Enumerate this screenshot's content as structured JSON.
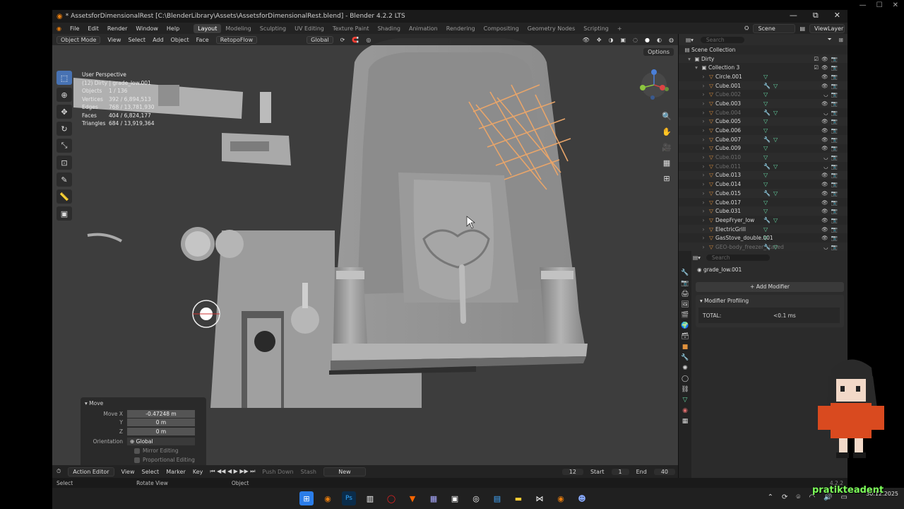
{
  "window": {
    "title": "* AssetsforDimensionalRest [C:\\BlenderLibrary\\Assets\\AssetsforDimensionalRest.blend] - Blender 4.2.2 LTS"
  },
  "menu": {
    "items": [
      "File",
      "Edit",
      "Render",
      "Window",
      "Help"
    ],
    "workspaces": [
      "Layout",
      "Modeling",
      "Sculpting",
      "UV Editing",
      "Texture Paint",
      "Shading",
      "Animation",
      "Rendering",
      "Compositing",
      "Geometry Nodes",
      "Scripting"
    ],
    "active_workspace": "Layout",
    "scene": "Scene",
    "view_layer": "ViewLayer"
  },
  "viewport_header": {
    "mode": "Object Mode",
    "menus": [
      "View",
      "Select",
      "Add",
      "Object",
      "Face",
      "RetopoFlow"
    ],
    "transform_orientation": "Global",
    "options_label": "Options"
  },
  "stats": {
    "view_name": "User Perspective",
    "object_name": "(12) Dirty | grade_low.001",
    "rows": [
      {
        "label": "Objects",
        "value": "1 / 136"
      },
      {
        "label": "Vertices",
        "value": "392 / 6,894,513"
      },
      {
        "label": "Edges",
        "value": "768 / 13,781,930"
      },
      {
        "label": "Faces",
        "value": "404 / 6,824,177"
      },
      {
        "label": "Triangles",
        "value": "684 / 13,919,364"
      }
    ]
  },
  "last_operation": {
    "title": "Move",
    "move_x_label": "Move X",
    "move_x": "-0.47248 m",
    "y_label": "Y",
    "y": "0 m",
    "z_label": "Z",
    "z": "0 m",
    "orientation_label": "Orientation",
    "orientation": "Global",
    "mirror_editing": "Mirror Editing",
    "proportional_editing": "Proportional Editing"
  },
  "timeline": {
    "editor": "Action Editor",
    "menus": [
      "View",
      "Select",
      "Marker",
      "Key"
    ],
    "push_down": "Push Down",
    "stash": "Stash",
    "new_label": "New",
    "current_frame": "12",
    "start_label": "Start",
    "start": "1",
    "end_label": "End",
    "end": "40"
  },
  "statusbar": {
    "items": [
      "Select",
      "Rotate View",
      "Object"
    ],
    "version": "4.2.2"
  },
  "outliner": {
    "search_placeholder": "Search",
    "scene_collection": "Scene Collection",
    "collection_dirty": "Dirty",
    "collection_3": "Collection 3",
    "objects": [
      {
        "name": "Circle.001",
        "dim": false
      },
      {
        "name": "Cube.001",
        "dim": false
      },
      {
        "name": "Cube.002",
        "dim": true
      },
      {
        "name": "Cube.003",
        "dim": false
      },
      {
        "name": "Cube.004",
        "dim": true
      },
      {
        "name": "Cube.005",
        "dim": false
      },
      {
        "name": "Cube.006",
        "dim": false
      },
      {
        "name": "Cube.007",
        "dim": false
      },
      {
        "name": "Cube.009",
        "dim": false
      },
      {
        "name": "Cube.010",
        "dim": true
      },
      {
        "name": "Cube.011",
        "dim": true
      },
      {
        "name": "Cube.013",
        "dim": false
      },
      {
        "name": "Cube.014",
        "dim": false
      },
      {
        "name": "Cube.015",
        "dim": false
      },
      {
        "name": "Cube.017",
        "dim": false
      },
      {
        "name": "Cube.031",
        "dim": false
      },
      {
        "name": "DeepFryer_low",
        "dim": false
      },
      {
        "name": "ElectricGrill",
        "dim": false
      },
      {
        "name": "GasStove_double.001",
        "dim": false
      },
      {
        "name": "GEO-body_freezer_stalled",
        "dim": true
      }
    ]
  },
  "properties": {
    "search_placeholder": "Search",
    "object_name": "grade_low.001",
    "add_modifier": "Add Modifier",
    "profiling_title": "Modifier Profiling",
    "total_label": "TOTAL:",
    "total_value": "<0.1 ms"
  },
  "taskbar": {
    "time": "",
    "date": "30.12.2025"
  },
  "overlay": {
    "streamer_name": "pratikteadent"
  },
  "colors": {
    "accent": "#4772b3",
    "selection_orange": "#e8a56a",
    "blender_orange": "#e87d0d",
    "viewport_bg": "#3d3d3d"
  }
}
